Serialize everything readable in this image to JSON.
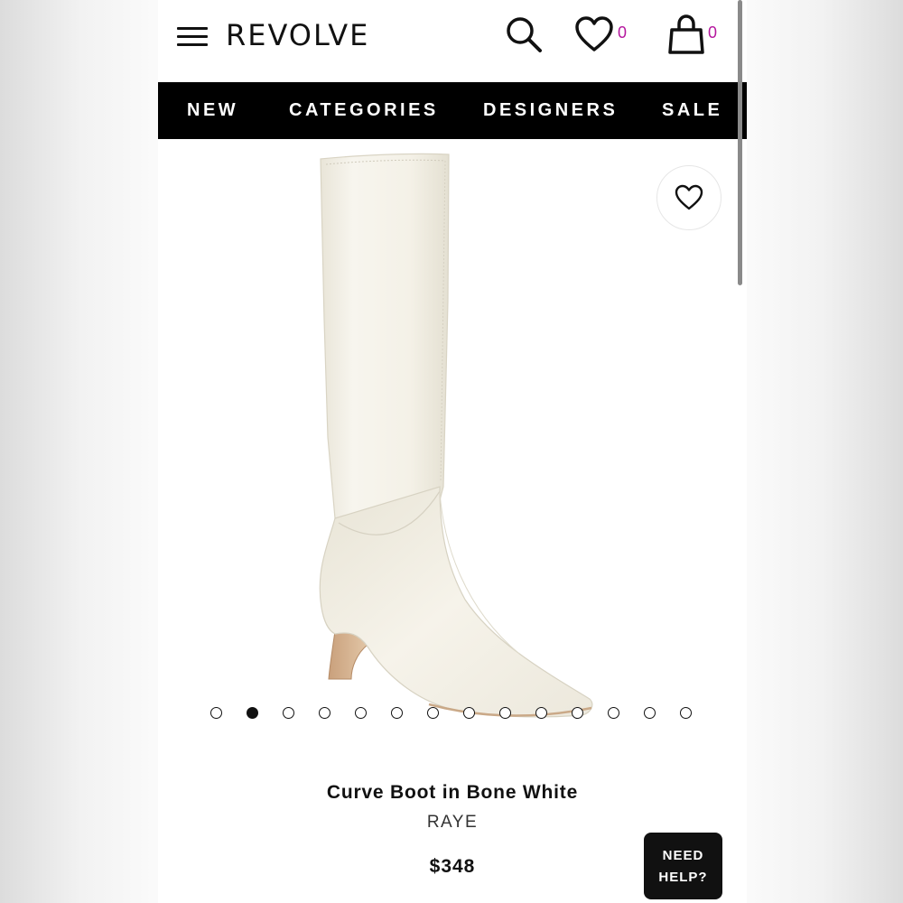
{
  "header": {
    "logo": "REVOLVE",
    "wishlist_count": "0",
    "bag_count": "0"
  },
  "nav": {
    "items": [
      "NEW",
      "CATEGORIES",
      "DESIGNERS",
      "SALE"
    ]
  },
  "gallery": {
    "total_images": 14,
    "active_index": 1
  },
  "product": {
    "name": "Curve Boot in Bone White",
    "brand": "RAYE",
    "price": "$348"
  },
  "help": {
    "line1": "NEED",
    "line2": "HELP?"
  },
  "colors": {
    "accent": "#b5179e",
    "nav_bg": "#000000",
    "boot": "#f3f0e6"
  },
  "icons": [
    "menu-icon",
    "search-icon",
    "heart-icon",
    "shopping-bag-icon",
    "favorite-heart-icon"
  ]
}
